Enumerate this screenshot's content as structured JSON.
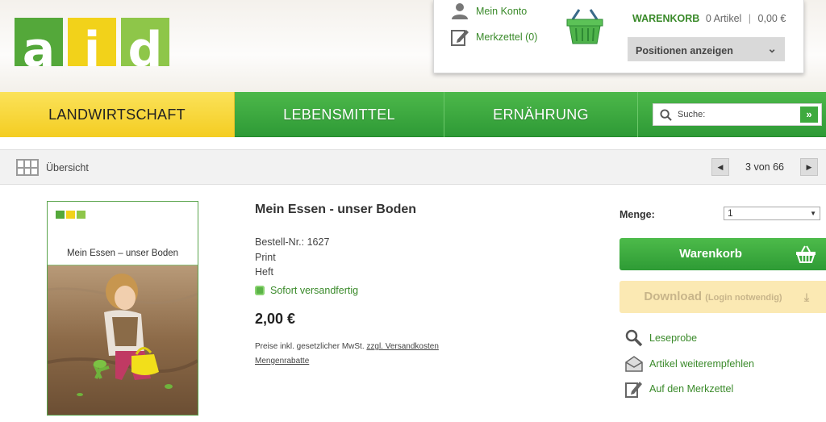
{
  "logo": {
    "letters": [
      "a",
      "i",
      "d"
    ]
  },
  "account": {
    "my_account": "Mein Konto",
    "wishlist": "Merkzettel (0)",
    "cart_label": "WARENKORB",
    "cart_items": "0 Artikel",
    "cart_separator": "|",
    "cart_total": "0,00 €",
    "show_positions": "Positionen anzeigen"
  },
  "nav": {
    "items": [
      "LANDWIRTSCHAFT",
      "LEBENSMITTEL",
      "ERNÄHRUNG"
    ],
    "active": "LANDWIRTSCHAFT",
    "search_placeholder": "Suche:",
    "search_go": "»"
  },
  "subbar": {
    "overview": "Übersicht",
    "pager_text": "3 von 66"
  },
  "product": {
    "cover_title": "Mein Essen – unser Boden",
    "title": "Mein Essen - unser Boden",
    "order_no": "Bestell-Nr.: 1627",
    "format": "Print",
    "binding": "Heft",
    "availability": "Sofort versandfertig",
    "price": "2,00 €",
    "price_note_prefix": "Preise inkl. gesetzlicher MwSt.",
    "shipping_link": "zzgl. Versandkosten",
    "discount_link": "Mengenrabatte"
  },
  "buy": {
    "quantity_label": "Menge:",
    "quantity_value": "1",
    "cart_button": "Warenkorb",
    "download_button": "Download",
    "download_note": "(Login notwendig)",
    "actions": [
      "Leseprobe",
      "Artikel weiterempfehlen",
      "Auf den Merkzettel"
    ]
  },
  "colors": {
    "green": "#3eaa3e",
    "yellow": "#f4cd22",
    "link_green": "#3a8a2a",
    "download_bg": "#fbe9b3"
  }
}
